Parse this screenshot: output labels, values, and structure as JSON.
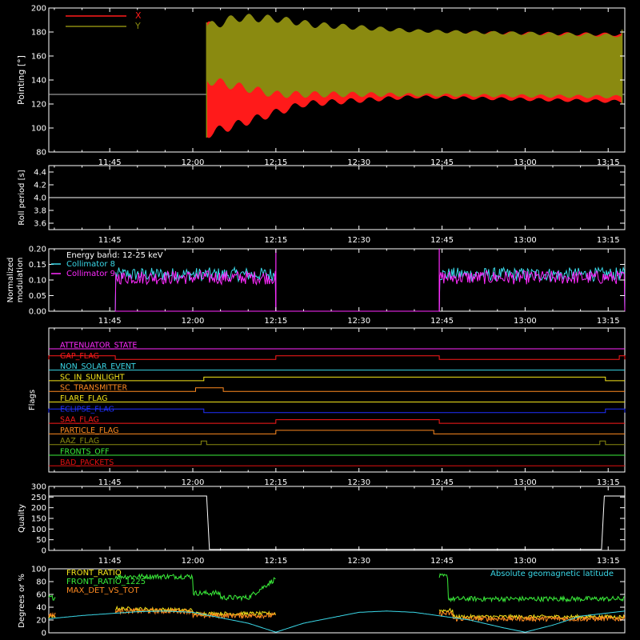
{
  "colors": {
    "background": "#000000",
    "axis": "#ffffff",
    "red": "#ff1a1a",
    "olive": "#8a8a10",
    "cyan": "#3ad8e8",
    "magenta": "#ff2aff",
    "orange": "#ff8a20",
    "yellow": "#f5e61a",
    "green": "#3aee3a",
    "blue": "#2030ff",
    "dark_red": "#e01010"
  },
  "time_ticks": [
    "11:45",
    "12:00",
    "12:15",
    "12:30",
    "12:45",
    "13:00",
    "13:15"
  ],
  "time_tick_minutes": [
    705,
    720,
    735,
    750,
    765,
    780,
    795
  ],
  "time_range_minutes": [
    694,
    798
  ],
  "chart_data": [
    {
      "id": "pointing",
      "type": "line",
      "ylabel": "Pointing [°]",
      "ylim": [
        80,
        200
      ],
      "yticks": [
        80,
        100,
        120,
        140,
        160,
        180,
        200
      ],
      "legend_position": "top-left",
      "series": [
        {
          "name": "X",
          "color": "#ff1a1a",
          "baseline": 128,
          "active_start": 722.5,
          "active_end": 797.5,
          "upper": [
            [
              722.5,
              185
            ],
            [
              740,
              183
            ],
            [
              760,
              180
            ],
            [
              797.5,
              178
            ]
          ],
          "lower": [
            [
              722.5,
              95
            ],
            [
              740,
              120
            ],
            [
              760,
              126
            ],
            [
              797.5,
              122
            ]
          ]
        },
        {
          "name": "Y",
          "color": "#8a8a10",
          "baseline": 128,
          "active_start": 722.5,
          "active_end": 797.5,
          "upper": [
            [
              722.5,
              184
            ],
            [
              728,
              192
            ],
            [
              735,
              191
            ],
            [
              742,
              186
            ],
            [
              760,
              181
            ],
            [
              797.5,
              177
            ]
          ],
          "lower": [
            [
              722.5,
              140
            ],
            [
              735,
              128
            ],
            [
              750,
              128
            ],
            [
              797.5,
              126
            ]
          ]
        }
      ]
    },
    {
      "id": "roll_period",
      "type": "line",
      "ylabel": "Roll period [s]",
      "ylim": [
        3.5,
        4.5
      ],
      "yticks": [
        3.6,
        3.8,
        4.0,
        4.2,
        4.4
      ],
      "series": [
        {
          "name": "",
          "color": "#ffffff",
          "value": 4.0
        }
      ]
    },
    {
      "id": "modulation",
      "type": "line",
      "ylabel": "Normalized modulation",
      "ylim": [
        0.0,
        0.2
      ],
      "yticks": [
        0.0,
        0.05,
        0.1,
        0.15,
        0.2
      ],
      "annotation": "Energy band: 12-25 keV",
      "series": [
        {
          "name": "Collimator 8",
          "color": "#3ad8e8",
          "mean": 0.118,
          "spread": 0.022,
          "segments": [
            [
              706,
              735
            ],
            [
              764.5,
              798
            ]
          ]
        },
        {
          "name": "Collimator 9",
          "color": "#ff2aff",
          "mean": 0.108,
          "spread": 0.022,
          "segments": [
            [
              706,
              735
            ],
            [
              764.5,
              798
            ]
          ]
        }
      ]
    },
    {
      "id": "flags",
      "type": "line",
      "ylabel": "Flags",
      "series": [
        {
          "name": "ATTENUATOR_STATE",
          "color": "#ff2aff",
          "intervals": []
        },
        {
          "name": "GAP_FLAG",
          "color": "#ff1a1a",
          "intervals": [
            [
              694,
              706
            ],
            [
              735,
              764.5
            ],
            [
              797,
              798
            ]
          ]
        },
        {
          "name": "NON_SOLAR_EVENT",
          "color": "#3ad8e8",
          "intervals": []
        },
        {
          "name": "SC_IN_SUNLIGHT",
          "color": "#f5e61a",
          "intervals": [
            [
              722,
              794.5
            ]
          ]
        },
        {
          "name": "SC_TRANSMITTER",
          "color": "#ff8a20",
          "intervals": [
            [
              720.5,
              725.5
            ]
          ]
        },
        {
          "name": "FLARE_FLAG",
          "color": "#f5e61a",
          "intervals": []
        },
        {
          "name": "ECLIPSE_FLAG",
          "color": "#2030ff",
          "intervals": [
            [
              694,
              722
            ],
            [
              794.5,
              798
            ]
          ]
        },
        {
          "name": "SAA_FLAG",
          "color": "#ff1a1a",
          "intervals": [
            [
              735,
              764.5
            ]
          ]
        },
        {
          "name": "PARTICLE_FLAG",
          "color": "#ff8a20",
          "intervals": [
            [
              735,
              763.5
            ]
          ]
        },
        {
          "name": "AAZ_FLAG",
          "color": "#8a8a10",
          "intervals": [
            [
              721.5,
              722.5
            ],
            [
              793.5,
              794.5
            ]
          ]
        },
        {
          "name": "FRONTS_OFF",
          "color": "#3aee3a",
          "intervals": []
        },
        {
          "name": "BAD_PACKETS",
          "color": "#e01010",
          "intervals": []
        }
      ]
    },
    {
      "id": "quality",
      "type": "line",
      "ylabel": "Quality",
      "ylim": [
        0,
        300
      ],
      "yticks": [
        0,
        50,
        100,
        150,
        200,
        250,
        300
      ],
      "series": [
        {
          "name": "",
          "color": "#ffffff",
          "points": [
            [
              694,
              255
            ],
            [
              722.5,
              255
            ],
            [
              723,
              5
            ],
            [
              793.8,
              5
            ],
            [
              794.3,
              255
            ],
            [
              798,
              255
            ]
          ]
        }
      ]
    },
    {
      "id": "front_ratio",
      "type": "line",
      "ylabel": "Degrees or %",
      "ylim": [
        0,
        100
      ],
      "yticks": [
        0,
        20,
        40,
        60,
        80,
        100
      ],
      "series": [
        {
          "name": "FRONT_RATIO",
          "color": "#f5e61a"
        },
        {
          "name": "FRONT_RATIO_1225",
          "color": "#3aee3a"
        },
        {
          "name": "MAX_DET_VS_TOT",
          "color": "#ff8a20"
        },
        {
          "name": "Absolute geomagnetic latitude",
          "color": "#3ad8e8",
          "points": [
            [
              694,
              22
            ],
            [
              700,
              27
            ],
            [
              710,
              33
            ],
            [
              715,
              34
            ],
            [
              720,
              32
            ],
            [
              730,
              15
            ],
            [
              735,
              1
            ],
            [
              740,
              15
            ],
            [
              750,
              32
            ],
            [
              755,
              34
            ],
            [
              760,
              32
            ],
            [
              770,
              20
            ],
            [
              776,
              8
            ],
            [
              780,
              1
            ],
            [
              785,
              12
            ],
            [
              790,
              26
            ],
            [
              798,
              34
            ]
          ]
        }
      ]
    }
  ]
}
